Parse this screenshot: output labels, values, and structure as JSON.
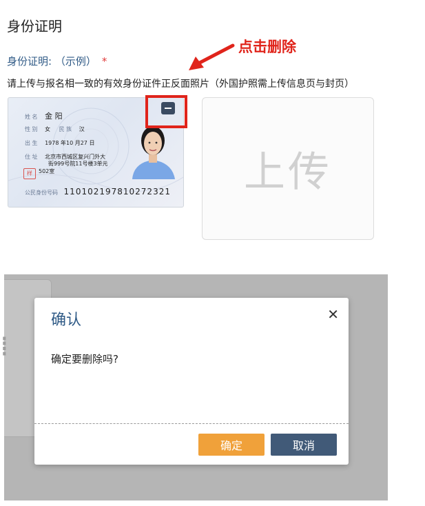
{
  "section": {
    "title": "身份证明"
  },
  "field": {
    "label": "身份证明: （示例）",
    "required_mark": "*"
  },
  "instruction": "请上传与报名相一致的有效身份证件正反面照片（外国护照需上传信息页与封页）",
  "annotation": "点击删除",
  "id_card": {
    "name_label": "姓 名",
    "name": "金 阳",
    "sex_label": "性 别",
    "sex": "女",
    "ethnicity_label": "民 族",
    "ethnicity": "汉",
    "birth_label": "出 生",
    "birth": "1978 年10 月27 日",
    "address_label": "住 址",
    "address_line1": "北京市西城区复兴门外大",
    "address_line2": "街999号院11号楼3单元",
    "address_line3": "502室",
    "number_label": "公民身份号码",
    "number": "110102197810272321",
    "stamp": "样"
  },
  "upload": {
    "label": "上传"
  },
  "dialog": {
    "title": "确认",
    "message": "确定要删除吗?",
    "confirm_label": "确定",
    "cancel_label": "取消"
  },
  "colors": {
    "accent_blue": "#2f5a86",
    "annotation_red": "#e0241b",
    "confirm_orange": "#f0a13a",
    "cancel_navy": "#415a78"
  }
}
